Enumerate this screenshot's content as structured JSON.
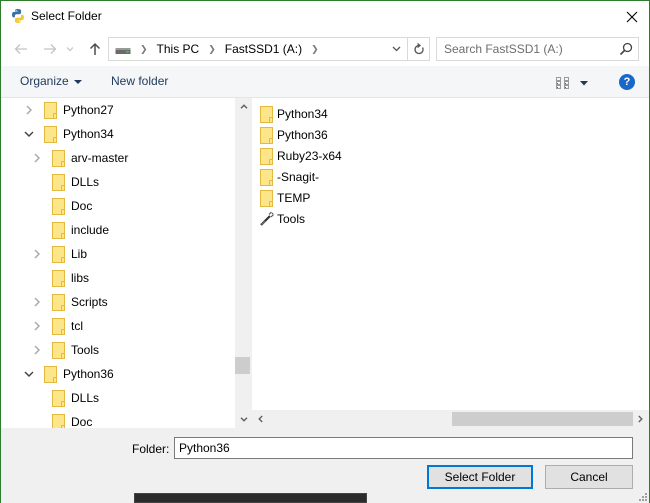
{
  "window": {
    "title": "Select Folder",
    "app_icon": "python-icon",
    "close_icon": "close-icon"
  },
  "navigation": {
    "back_icon": "arrow-left-icon",
    "forward_icon": "arrow-right-icon",
    "recent_icon": "chevron-down-icon",
    "up_icon": "arrow-up-icon",
    "address": {
      "drive_icon": "drive-icon",
      "breadcrumbs": [
        "This PC",
        "FastSSD1 (A:)"
      ],
      "dropdown_icon": "chevron-down-icon",
      "refresh_icon": "refresh-icon"
    },
    "search": {
      "placeholder": "Search FastSSD1 (A:)",
      "value": "",
      "icon": "search-icon"
    }
  },
  "command_bar": {
    "organize_label": "Organize",
    "new_folder_label": "New folder",
    "views_icon": "view-options-icon",
    "help_icon": "help-icon",
    "help_glyph": "?"
  },
  "tree": {
    "items": [
      {
        "label": "Python27",
        "level": 1,
        "expander": "collapsed"
      },
      {
        "label": "Python34",
        "level": 1,
        "expander": "expanded"
      },
      {
        "label": "arv-master",
        "level": 2,
        "expander": "collapsed"
      },
      {
        "label": "DLLs",
        "level": 2,
        "expander": "none"
      },
      {
        "label": "Doc",
        "level": 2,
        "expander": "none"
      },
      {
        "label": "include",
        "level": 2,
        "expander": "none"
      },
      {
        "label": "Lib",
        "level": 2,
        "expander": "collapsed"
      },
      {
        "label": "libs",
        "level": 2,
        "expander": "none"
      },
      {
        "label": "Scripts",
        "level": 2,
        "expander": "collapsed"
      },
      {
        "label": "tcl",
        "level": 2,
        "expander": "collapsed"
      },
      {
        "label": "Tools",
        "level": 2,
        "expander": "collapsed"
      },
      {
        "label": "Python36",
        "level": 1,
        "expander": "expanded"
      },
      {
        "label": "DLLs",
        "level": 2,
        "expander": "none"
      },
      {
        "label": "Doc",
        "level": 2,
        "expander": "none"
      }
    ]
  },
  "list": {
    "items": [
      {
        "label": "Python34",
        "icon": "folder-icon"
      },
      {
        "label": "Python36",
        "icon": "folder-icon"
      },
      {
        "label": "Ruby23-x64",
        "icon": "folder-icon"
      },
      {
        "label": "-Snagit-",
        "icon": "folder-icon"
      },
      {
        "label": "TEMP",
        "icon": "folder-icon"
      },
      {
        "label": "Tools",
        "icon": "tools-icon"
      }
    ]
  },
  "footer": {
    "folder_label": "Folder:",
    "folder_value": "Python36",
    "select_button": "Select Folder",
    "cancel_button": "Cancel"
  },
  "colors": {
    "window_border": "#2d7d2d",
    "accent": "#0078d7",
    "link_text": "#1e395b",
    "folder_fill": "#fde58a",
    "folder_edge": "#e4b940",
    "help_blue": "#1768c9"
  }
}
